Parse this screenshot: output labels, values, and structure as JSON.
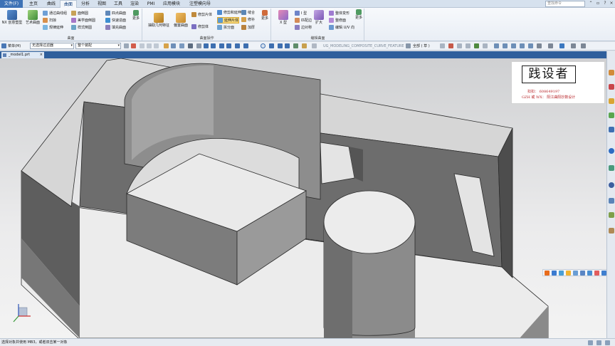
{
  "menu": {
    "tabs": [
      "文件(F)",
      "主页",
      "曲线",
      "曲面",
      "分析",
      "视图",
      "工具",
      "渲染",
      "PMI",
      "应用模块",
      "注塑模向导"
    ],
    "active_tab": "曲面",
    "search_placeholder": "查找命令"
  },
  "ribbon": {
    "group_surface": {
      "label": "曲面",
      "nx_creative": "NX 创意塑型",
      "art_surface": "艺术曲面",
      "through_curves": "通过曲线组",
      "sweep": "扫掠",
      "law_extension": "规律延伸",
      "studio_surface": "面倒圆",
      "aesthetic_face_blend": "美学面倒圆",
      "styled_blend": "样式倒圆",
      "four_point_surface": "四点曲面",
      "rapid_surfacing": "快速造面",
      "fill_surface": "填充曲面",
      "more": "更多"
    },
    "group_surface_ops": {
      "label": "曲面操作",
      "extract_geometry": "抽取几何特征",
      "offset_surface": "偏置曲面",
      "trim_sheet": "修剪片体",
      "trim_extend": "修剪和延伸",
      "extend_sheet": "延伸片体",
      "patch": "修剪体",
      "divide_face": "拆分面",
      "sew": "缝合",
      "thicken": "加厚",
      "shrink": "修补",
      "more": "更多"
    },
    "group_edit_surface": {
      "label": "编辑曲面",
      "x_form": "X 型",
      "i_form": "I 型",
      "match_edge": "匹配边",
      "edge_symmetry": "边对称",
      "enlarge": "扩大",
      "global_shaping": "整体变形",
      "reshape": "整修面",
      "edit_uv": "编辑 U/V 向",
      "more": "更多"
    }
  },
  "toolbar": {
    "menu_button": "菜单(M)",
    "filter_value": "无选择过滤器",
    "assembly_scope": "整个装配",
    "feature_hint": "UG_MODELING_COMPOSITE_CURVE_FEATURE",
    "full_label": "全部 ( 草 )"
  },
  "document": {
    "tab_title": "_model1.prt",
    "close": "×"
  },
  "watermark": {
    "logo_text": "践设者",
    "line1": "扣扣：  608649197",
    "line2": "GZH 或 WX：  阳江曲阳抄数设计"
  },
  "status": {
    "message": "选择对象并使用 MB3，或者双击某一对象"
  },
  "colors": {
    "file_tab": "#3e72b6",
    "doc_tab_bar": "#2f5f9c",
    "model_face_light": "#e6e6e6",
    "model_face_dark": "#6b6b6b",
    "watermark_text": "#b8262a"
  }
}
